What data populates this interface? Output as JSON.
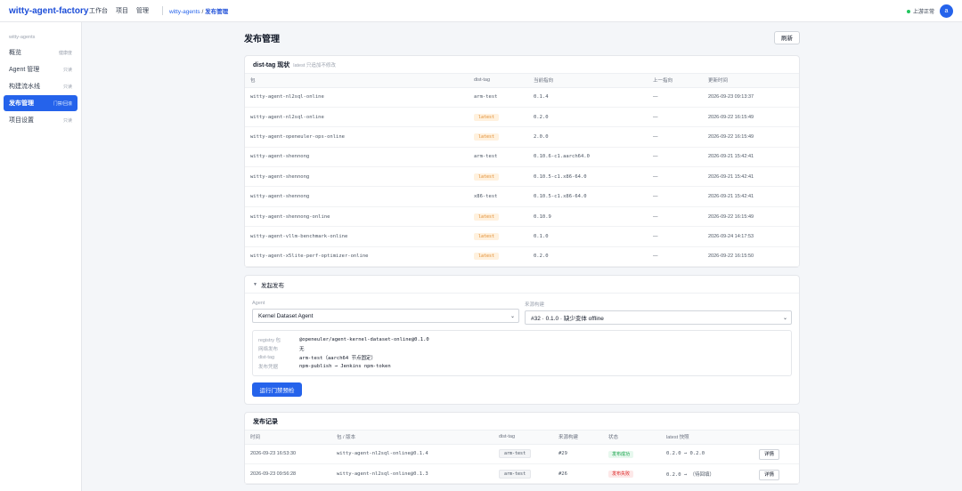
{
  "app": {
    "brand": "witty-agent-factory",
    "nav": [
      "工作台",
      "项目",
      "管理"
    ],
    "breadcrumb_project": "witty-agents",
    "breadcrumb_sep": " / ",
    "breadcrumb_page": "发布管理",
    "status": "上游正常",
    "avatar": "a"
  },
  "sidebar": {
    "section": "witty-agents",
    "items": [
      {
        "label": "概览",
        "tag": "健康度"
      },
      {
        "label": "Agent 管理",
        "tag": "只读"
      },
      {
        "label": "构建流水线",
        "tag": "只读"
      },
      {
        "label": "发布管理",
        "tag": "门禁/回滚"
      },
      {
        "label": "项目设置",
        "tag": "只读"
      }
    ]
  },
  "page": {
    "title": "发布管理",
    "refresh": "刷新"
  },
  "disttag": {
    "title": "dist-tag 现状",
    "subtitle": "latest 只追加不修改",
    "columns": [
      "包",
      "dist-tag",
      "当前指向",
      "上一指向",
      "更新时间"
    ],
    "rows": [
      {
        "pkg": "witty-agent-nl2sql-online",
        "tag": "arm-test",
        "latest": false,
        "cur": "0.1.4",
        "prev": "—",
        "time": "2026-09-23 09:13:37"
      },
      {
        "pkg": "witty-agent-nl2sql-online",
        "tag": "latest",
        "latest": true,
        "cur": "0.2.0",
        "prev": "—",
        "time": "2026-09-22 16:15:49"
      },
      {
        "pkg": "witty-agent-openeuler-ops-online",
        "tag": "latest",
        "latest": true,
        "cur": "2.0.0",
        "prev": "—",
        "time": "2026-09-22 16:15:49"
      },
      {
        "pkg": "witty-agent-shennong",
        "tag": "arm-test",
        "latest": false,
        "cur": "0.10.6-c1.aarch64.0",
        "prev": "—",
        "time": "2026-09-21 15:42:41"
      },
      {
        "pkg": "witty-agent-shennong",
        "tag": "latest",
        "latest": true,
        "cur": "0.10.5-c1.x86-64.0",
        "prev": "—",
        "time": "2026-09-21 15:42:41"
      },
      {
        "pkg": "witty-agent-shennong",
        "tag": "x86-test",
        "latest": false,
        "cur": "0.10.5-c1.x86-64.0",
        "prev": "—",
        "time": "2026-09-21 15:42:41"
      },
      {
        "pkg": "witty-agent-shennong-online",
        "tag": "latest",
        "latest": true,
        "cur": "0.10.9",
        "prev": "—",
        "time": "2026-09-22 16:15:49"
      },
      {
        "pkg": "witty-agent-vllm-benchmark-online",
        "tag": "latest",
        "latest": true,
        "cur": "0.1.0",
        "prev": "—",
        "time": "2026-09-24 14:17:53"
      },
      {
        "pkg": "witty-agent-x5lite-perf-optimizer-online",
        "tag": "latest",
        "latest": true,
        "cur": "0.2.0",
        "prev": "—",
        "time": "2026-09-22 16:15:50"
      }
    ]
  },
  "publish": {
    "title": "发起发布",
    "agent_label": "Agent",
    "agent_value": "Kernel Dataset Agent",
    "source_label": "来源构建",
    "source_value": "#32 · 0.1.0 · 缺少变体 offline",
    "info": [
      {
        "k": "registry 包",
        "v": "@openeuler/agent-kernel-dataset-online@0.1.0"
      },
      {
        "k": "网络发布",
        "v": "无"
      },
      {
        "k": "dist-tag",
        "v": "arm-test（aarch64 节点固定）"
      },
      {
        "k": "发布凭据",
        "v": "npm-publish → Jenkins npm-token"
      }
    ],
    "run_button": "运行门禁预检"
  },
  "records": {
    "title": "发布记录",
    "columns": [
      "时间",
      "包 / 版本",
      "dist-tag",
      "来源构建",
      "状态",
      "latest 快照",
      ""
    ],
    "rows": [
      {
        "time": "2026-09-23 16:53:30",
        "pkg": "witty-agent-nl2sql-online@0.1.4",
        "tag": "arm-test",
        "build": "#29",
        "status": "发布成功",
        "ok": true,
        "snap": "0.2.0 → 0.2.0",
        "action": "详情"
      },
      {
        "time": "2026-09-23 09:56:28",
        "pkg": "witty-agent-nl2sql-online@0.1.3",
        "tag": "arm-test",
        "build": "#26",
        "status": "发布失败",
        "ok": false,
        "snap": "0.2.0 → （待回填）",
        "action": "详情"
      }
    ]
  },
  "colors": {
    "accent": "#2563eb",
    "latest_badge": "#fff1de",
    "success": "#16a34a",
    "failure": "#dc2626"
  }
}
